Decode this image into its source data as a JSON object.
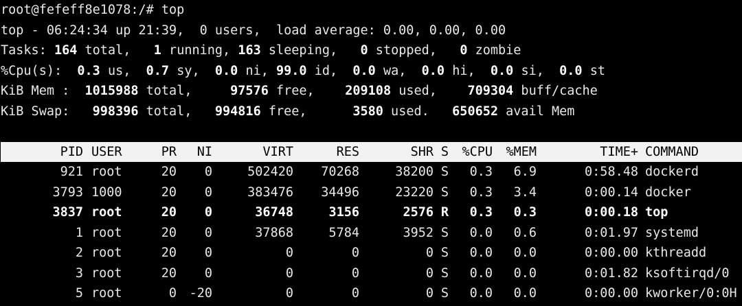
{
  "prompt": "root@fefeff8e1078:/# top",
  "summary": {
    "line1": "top - 06:24:34 up 21:39,  0 users,  load average: 0.00, 0.00, 0.00",
    "tasks": {
      "label": "Tasks: ",
      "total": "164",
      "total_suffix": " total,   ",
      "running": "1",
      "running_suffix": " running, ",
      "sleeping": "163",
      "sleeping_suffix": " sleeping,   ",
      "stopped": "0",
      "stopped_suffix": " stopped,   ",
      "zombie": "0",
      "zombie_suffix": " zombie"
    },
    "cpu": {
      "label": "%Cpu(s):  ",
      "us": "0.3",
      "us_suffix": " us,  ",
      "sy": "0.7",
      "sy_suffix": " sy,  ",
      "ni": "0.0",
      "ni_suffix": " ni, ",
      "id": "99.0",
      "id_suffix": " id,  ",
      "wa": "0.0",
      "wa_suffix": " wa,  ",
      "hi": "0.0",
      "hi_suffix": " hi,  ",
      "si": "0.0",
      "si_suffix": " si,  ",
      "st": "0.0",
      "st_suffix": " st"
    },
    "mem": {
      "label": "KiB Mem :  ",
      "total": "1015988",
      "total_suffix": " total,     ",
      "free": "97576",
      "free_suffix": " free,    ",
      "used": "209108",
      "used_suffix": " used,    ",
      "cache": "709304",
      "cache_suffix": " buff/cache"
    },
    "swap": {
      "label": "KiB Swap:   ",
      "total": "998396",
      "total_suffix": " total,   ",
      "free": "994816",
      "free_suffix": " free,      ",
      "used": "3580",
      "used_suffix": " used.   ",
      "avail": "650652",
      "avail_suffix": " avail Mem"
    }
  },
  "table": {
    "headers": {
      "pid": "PID",
      "user": "USER",
      "pr": "PR",
      "ni": "NI",
      "virt": "VIRT",
      "res": "RES",
      "shr": "SHR",
      "s": "S",
      "cpu": "%CPU",
      "mem": "%MEM",
      "time": "TIME+",
      "command": "COMMAND"
    },
    "rows": [
      {
        "pid": "921",
        "user": "root",
        "pr": "20",
        "ni": "0",
        "virt": "502420",
        "res": "70268",
        "shr": "38200",
        "s": "S",
        "cpu": "0.3",
        "mem": "6.9",
        "time": "0:58.48",
        "command": "dockerd"
      },
      {
        "pid": "3793",
        "user": "1000",
        "pr": "20",
        "ni": "0",
        "virt": "383476",
        "res": "34496",
        "shr": "23220",
        "s": "S",
        "cpu": "0.3",
        "mem": "3.4",
        "time": "0:00.14",
        "command": "docker"
      },
      {
        "pid": "3837",
        "user": "root",
        "pr": "20",
        "ni": "0",
        "virt": "36748",
        "res": "3156",
        "shr": "2576",
        "s": "R",
        "cpu": "0.3",
        "mem": "0.3",
        "time": "0:00.18",
        "command": "top"
      },
      {
        "pid": "1",
        "user": "root",
        "pr": "20",
        "ni": "0",
        "virt": "37868",
        "res": "5784",
        "shr": "3952",
        "s": "S",
        "cpu": "0.0",
        "mem": "0.6",
        "time": "0:01.97",
        "command": "systemd"
      },
      {
        "pid": "2",
        "user": "root",
        "pr": "20",
        "ni": "0",
        "virt": "0",
        "res": "0",
        "shr": "0",
        "s": "S",
        "cpu": "0.0",
        "mem": "0.0",
        "time": "0:00.00",
        "command": "kthreadd"
      },
      {
        "pid": "3",
        "user": "root",
        "pr": "20",
        "ni": "0",
        "virt": "0",
        "res": "0",
        "shr": "0",
        "s": "S",
        "cpu": "0.0",
        "mem": "0.0",
        "time": "0:01.82",
        "command": "ksoftirqd/0"
      },
      {
        "pid": "5",
        "user": "root",
        "pr": "0",
        "ni": "-20",
        "virt": "0",
        "res": "0",
        "shr": "0",
        "s": "S",
        "cpu": "0.0",
        "mem": "0.0",
        "time": "0:00.00",
        "command": "kworker/0:0H"
      }
    ]
  },
  "colors": {
    "background": "#000000",
    "text": "#e8e8e8",
    "header_bg": "#f2f2f2",
    "header_text": "#000000"
  }
}
